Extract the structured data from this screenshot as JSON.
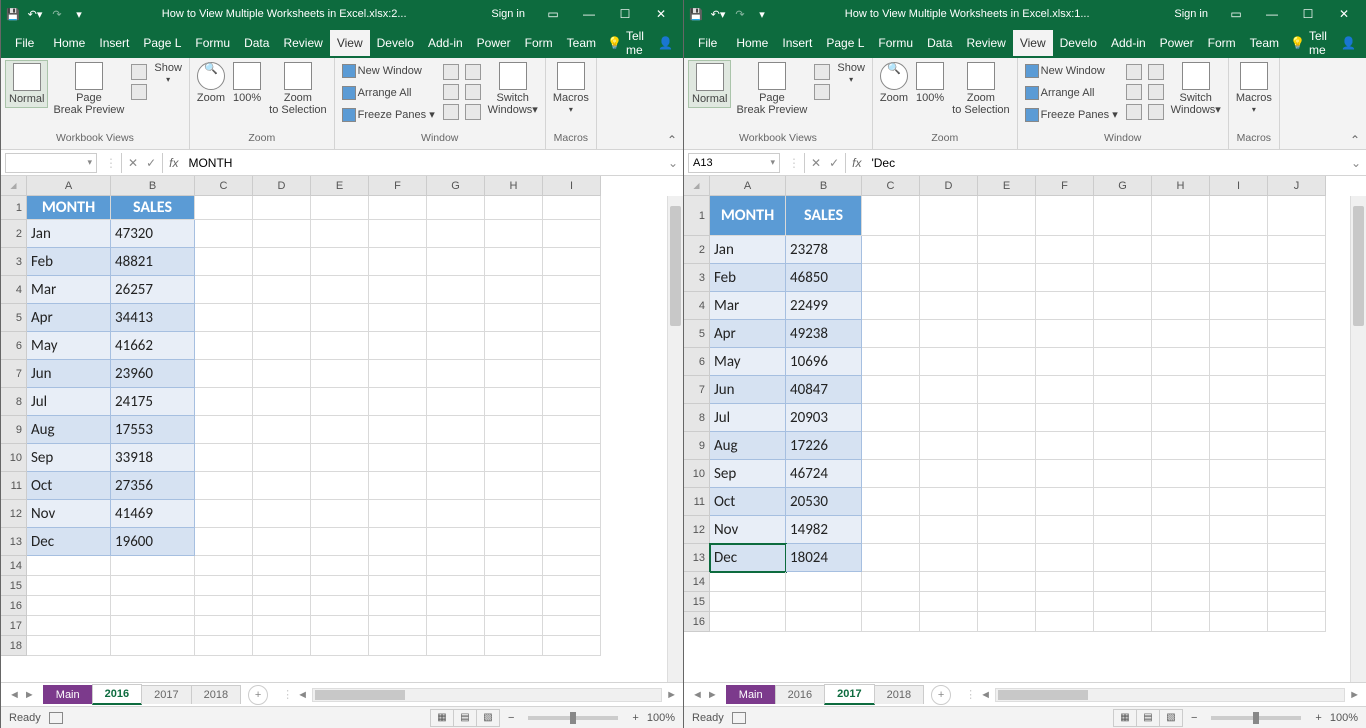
{
  "left": {
    "title": "How to View Multiple Worksheets in Excel.xlsx:2...",
    "signin": "Sign in",
    "menus": [
      "File",
      "Home",
      "Insert",
      "Page L",
      "Formu",
      "Data",
      "Review",
      "View",
      "Develo",
      "Add-in",
      "Power",
      "Form",
      "Team"
    ],
    "active_menu": "View",
    "tellme": "Tell me",
    "ribbon": {
      "workbook_views": {
        "label": "Workbook Views",
        "btns": [
          "Normal",
          "Page Break Preview",
          "Show"
        ]
      },
      "zoom": {
        "label": "Zoom",
        "btns": [
          "Zoom",
          "100%",
          "Zoom to Selection"
        ]
      },
      "window": {
        "label": "Window",
        "rows": [
          "New Window",
          "Arrange All",
          "Freeze Panes"
        ],
        "switch": "Switch Windows"
      },
      "macros": {
        "label": "Macros",
        "btn": "Macros"
      }
    },
    "namebox": "",
    "formula": "MONTH",
    "cols": [
      "A",
      "B",
      "C",
      "D",
      "E",
      "F",
      "G",
      "H",
      "I"
    ],
    "headers": [
      "MONTH",
      "SALES"
    ],
    "rows": [
      [
        "Jan",
        "47320"
      ],
      [
        "Feb",
        "48821"
      ],
      [
        "Mar",
        "26257"
      ],
      [
        "Apr",
        "34413"
      ],
      [
        "May",
        "41662"
      ],
      [
        "Jun",
        "23960"
      ],
      [
        "Jul",
        "24175"
      ],
      [
        "Aug",
        "17553"
      ],
      [
        "Sep",
        "33918"
      ],
      [
        "Oct",
        "27356"
      ],
      [
        "Nov",
        "41469"
      ],
      [
        "Dec",
        "19600"
      ]
    ],
    "empty_rows": [
      "14",
      "15",
      "16",
      "17",
      "18"
    ],
    "sheets": [
      "Main",
      "2016",
      "2017",
      "2018"
    ],
    "active_sheet": "2016",
    "status": "Ready",
    "zoom": "100%"
  },
  "right": {
    "title": "How to View Multiple Worksheets in Excel.xlsx:1...",
    "signin": "Sign in",
    "menus": [
      "File",
      "Home",
      "Insert",
      "Page L",
      "Formu",
      "Data",
      "Review",
      "View",
      "Develo",
      "Add-in",
      "Power",
      "Form",
      "Team"
    ],
    "active_menu": "View",
    "tellme": "Tell me",
    "ribbon": {
      "workbook_views": {
        "label": "Workbook Views",
        "btns": [
          "Normal",
          "Page Break Preview",
          "Show"
        ]
      },
      "zoom": {
        "label": "Zoom",
        "btns": [
          "Zoom",
          "100%",
          "Zoom to Selection"
        ]
      },
      "window": {
        "label": "Window",
        "rows": [
          "New Window",
          "Arrange All",
          "Freeze Panes"
        ],
        "switch": "Switch Windows"
      },
      "macros": {
        "label": "Macros",
        "btn": "Macros"
      }
    },
    "namebox": "A13",
    "formula": "'Dec",
    "cols": [
      "A",
      "B",
      "C",
      "D",
      "E",
      "F",
      "G",
      "H",
      "I",
      "J"
    ],
    "headers": [
      "MONTH",
      "SALES"
    ],
    "rows": [
      [
        "Jan",
        "23278"
      ],
      [
        "Feb",
        "46850"
      ],
      [
        "Mar",
        "22499"
      ],
      [
        "Apr",
        "49238"
      ],
      [
        "May",
        "10696"
      ],
      [
        "Jun",
        "40847"
      ],
      [
        "Jul",
        "20903"
      ],
      [
        "Aug",
        "17226"
      ],
      [
        "Sep",
        "46724"
      ],
      [
        "Oct",
        "20530"
      ],
      [
        "Nov",
        "14982"
      ],
      [
        "Dec",
        "18024"
      ]
    ],
    "empty_rows": [
      "14",
      "15",
      "16"
    ],
    "sheets": [
      "Main",
      "2016",
      "2017",
      "2018"
    ],
    "active_sheet": "2017",
    "status": "Ready",
    "zoom": "100%",
    "selected_cell": "A13"
  }
}
